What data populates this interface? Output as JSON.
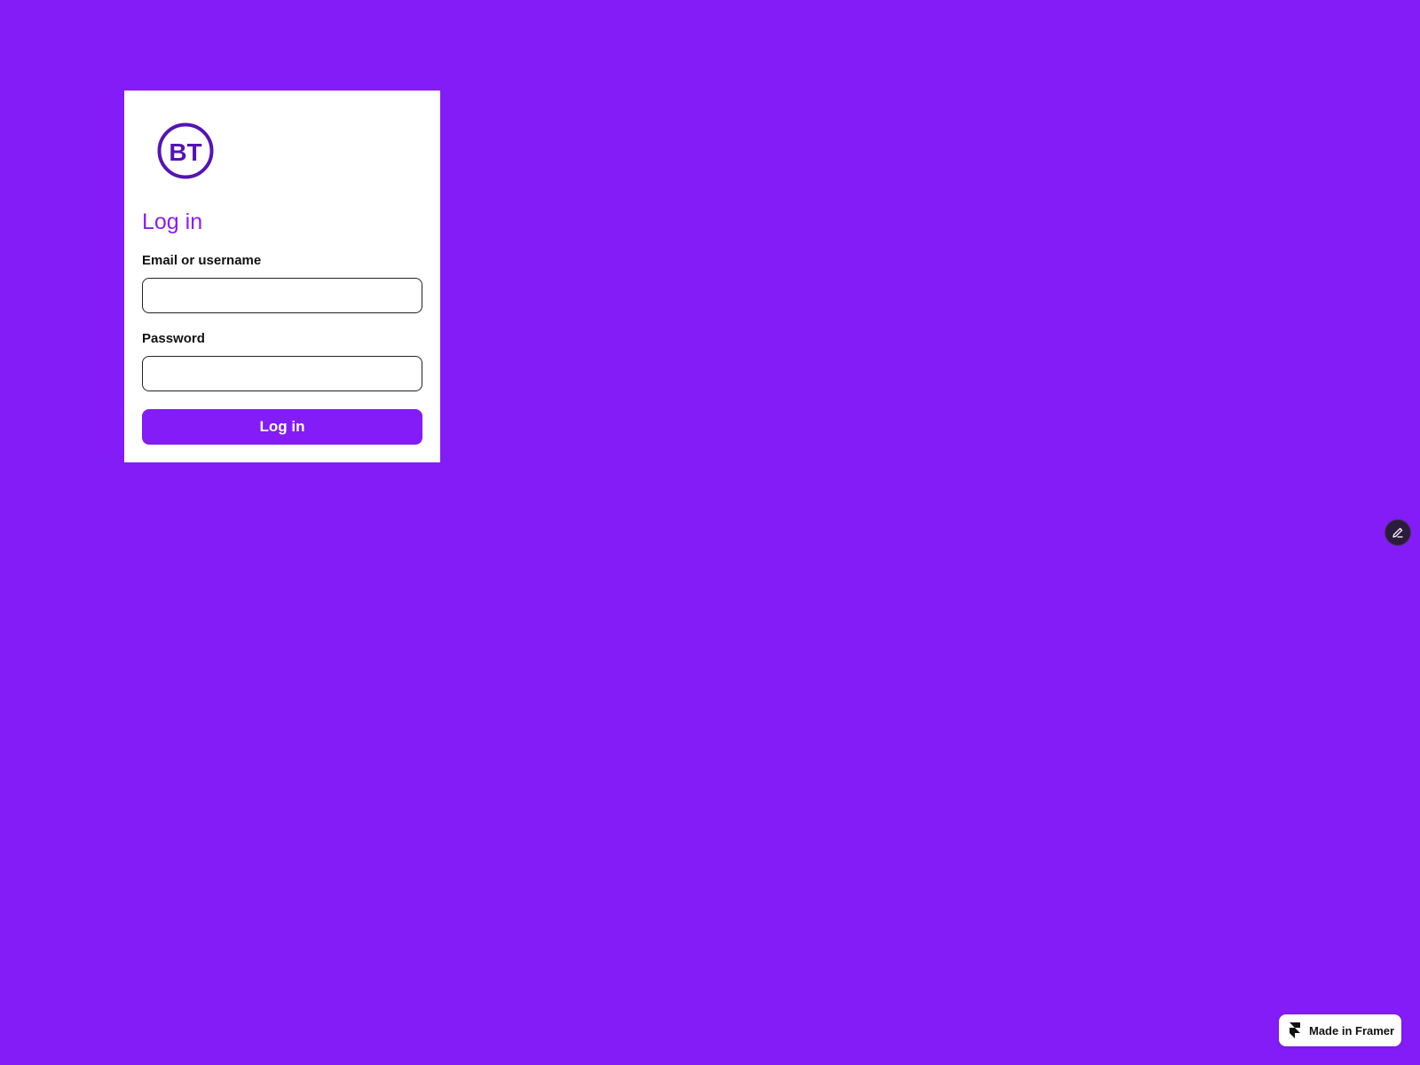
{
  "colors": {
    "background": "#831cf6",
    "card": "#ffffff",
    "accent": "#831cf6",
    "title": "#8c1df7",
    "logo": "#5514b4"
  },
  "logo": {
    "icon": "bt-logo-icon",
    "text": "BT"
  },
  "login": {
    "title": "Log in",
    "email_label": "Email or username",
    "email_value": "",
    "email_placeholder": "",
    "password_label": "Password",
    "password_value": "",
    "password_placeholder": "",
    "submit_label": "Log in"
  },
  "edit_button": {
    "icon": "pencil-icon"
  },
  "framer_badge": {
    "icon": "framer-icon",
    "label": "Made in Framer"
  }
}
